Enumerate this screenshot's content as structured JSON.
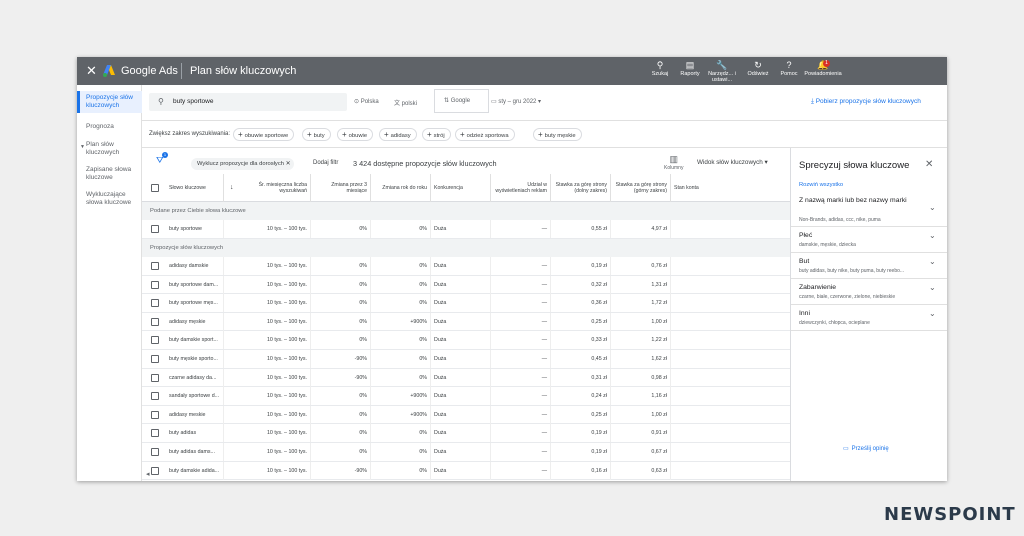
{
  "topbar": {
    "brand": "Google Ads",
    "page_title": "Plan słów kluczowych",
    "tools": [
      {
        "label": "Szukaj",
        "icon": "search-icon"
      },
      {
        "label": "Raporty",
        "icon": "reports-icon"
      },
      {
        "label": "Narzędz... i ustawi...",
        "icon": "wrench-icon"
      },
      {
        "label": "Odśwież",
        "icon": "refresh-icon"
      },
      {
        "label": "Pomoc",
        "icon": "help-icon"
      },
      {
        "label": "Powiadomienia",
        "icon": "bell-icon"
      }
    ],
    "notification_count": "1"
  },
  "sidebar": {
    "items": [
      {
        "label": "Propozycje słów kluczowych"
      },
      {
        "label": "Prognoza"
      },
      {
        "label": "Plan słów kluczowych"
      },
      {
        "label": "Zapisane słowa kluczowe"
      },
      {
        "label": "Wykluczające słowa kluczowe"
      }
    ]
  },
  "search": {
    "query": "buty sportowe",
    "location": "Polska",
    "language": "polski",
    "network": "Google",
    "date_range": "sty – gru 2022",
    "download_label": "Pobierz propozycje słów kluczowych"
  },
  "expand": {
    "label": "Zwiększ zakres wyszukiwania:",
    "pills": [
      "obuwie sportowe",
      "buty",
      "obuwie",
      "adidasy",
      "strój",
      "odzież sportowa",
      "buty męskie"
    ]
  },
  "filters": {
    "adult_chip": "Wyklucz propozycje dla dorosłych",
    "add_filter": "Dodaj filtr",
    "count_text": "3 424 dostępne propozycje słów kluczowych",
    "filter_count": "1",
    "columns_label": "Kolumny",
    "view_label": "Widok słów kluczowych"
  },
  "table": {
    "headers": {
      "keyword": "Słowo kluczowe",
      "avg": "Śr. miesięczna liczba wyszukiwań",
      "change3": "Zmiana przez 3 miesiące",
      "yoy": "Zmiana rok do roku",
      "competition": "Konkurencja",
      "impression_share": "Udział w wyświetleniach reklam",
      "bid_low": "Stawka za górę strony (dolny zakres)",
      "bid_high": "Stawka za górę strony (górny zakres)",
      "account_status": "Stan konta"
    },
    "group_provided": "Podane przez Ciebie słowa kluczowe",
    "group_ideas": "Propozycje słów kluczowych",
    "provided_rows": [
      {
        "keyword": "buty sportowe",
        "avg": "10 tys. – 100 tys.",
        "change3": "0%",
        "yoy": "0%",
        "comp": "Duża",
        "share": "—",
        "low": "0,55 zł",
        "high": "4,97 zł"
      }
    ],
    "idea_rows": [
      {
        "keyword": "adidasy damskie",
        "avg": "10 tys. – 100 tys.",
        "change3": "0%",
        "yoy": "0%",
        "comp": "Duża",
        "share": "—",
        "low": "0,19 zł",
        "high": "0,76 zł"
      },
      {
        "keyword": "buty sportowe dam...",
        "avg": "10 tys. – 100 tys.",
        "change3": "0%",
        "yoy": "0%",
        "comp": "Duża",
        "share": "—",
        "low": "0,32 zł",
        "high": "1,31 zł"
      },
      {
        "keyword": "buty sportowe męs...",
        "avg": "10 tys. – 100 tys.",
        "change3": "0%",
        "yoy": "0%",
        "comp": "Duża",
        "share": "—",
        "low": "0,36 zł",
        "high": "1,72 zł"
      },
      {
        "keyword": "adidasy męskie",
        "avg": "10 tys. – 100 tys.",
        "change3": "0%",
        "yoy": "+900%",
        "comp": "Duża",
        "share": "—",
        "low": "0,25 zł",
        "high": "1,00 zł"
      },
      {
        "keyword": "buty damskie sport...",
        "avg": "10 tys. – 100 tys.",
        "change3": "0%",
        "yoy": "0%",
        "comp": "Duża",
        "share": "—",
        "low": "0,33 zł",
        "high": "1,22 zł"
      },
      {
        "keyword": "buty męskie sporto...",
        "avg": "10 tys. – 100 tys.",
        "change3": "-90%",
        "yoy": "0%",
        "comp": "Duża",
        "share": "—",
        "low": "0,45 zł",
        "high": "1,62 zł"
      },
      {
        "keyword": "czarne adidasy da...",
        "avg": "10 tys. – 100 tys.",
        "change3": "-90%",
        "yoy": "0%",
        "comp": "Duża",
        "share": "—",
        "low": "0,31 zł",
        "high": "0,98 zł"
      },
      {
        "keyword": "sandały sportowe d...",
        "avg": "10 tys. – 100 tys.",
        "change3": "0%",
        "yoy": "+900%",
        "comp": "Duża",
        "share": "—",
        "low": "0,24 zł",
        "high": "1,16 zł"
      },
      {
        "keyword": "adidasy meskie",
        "avg": "10 tys. – 100 tys.",
        "change3": "0%",
        "yoy": "+900%",
        "comp": "Duża",
        "share": "—",
        "low": "0,25 zł",
        "high": "1,00 zł"
      },
      {
        "keyword": "buty adidas",
        "avg": "10 tys. – 100 tys.",
        "change3": "0%",
        "yoy": "0%",
        "comp": "Duża",
        "share": "—",
        "low": "0,19 zł",
        "high": "0,91 zł"
      },
      {
        "keyword": "buty adidas dams...",
        "avg": "10 tys. – 100 tys.",
        "change3": "0%",
        "yoy": "0%",
        "comp": "Duża",
        "share": "—",
        "low": "0,19 zł",
        "high": "0,67 zł"
      },
      {
        "keyword": "buty damskie adida...",
        "avg": "10 tys. – 100 tys.",
        "change3": "-90%",
        "yoy": "0%",
        "comp": "Duża",
        "share": "—",
        "low": "0,16 zł",
        "high": "0,63 zł"
      }
    ]
  },
  "panel": {
    "title": "Sprecyzuj słowa kluczowe",
    "expand_all": "Rozwiń wszystko",
    "facets": [
      {
        "title": "Z nazwą marki lub bez nazwy marki",
        "sub": "Non-Brands, adidas, ccc, nike, puma"
      },
      {
        "title": "Płeć",
        "sub": "damskie, męskie, dziecka"
      },
      {
        "title": "But",
        "sub": "buty adidas, buty nike, buty puma, buty reebo..."
      },
      {
        "title": "Zabarwienie",
        "sub": "czarne, białe, czerwone, zielone, niebieskie"
      },
      {
        "title": "Inni",
        "sub": "dziewczynki, chłopca, ocieplane"
      }
    ],
    "feedback": "Prześlij opinię"
  },
  "watermark": "NEWSPOINT",
  "colors": {
    "accent": "#1a73e8",
    "topbar": "#5f6368",
    "alert": "#d93025"
  }
}
